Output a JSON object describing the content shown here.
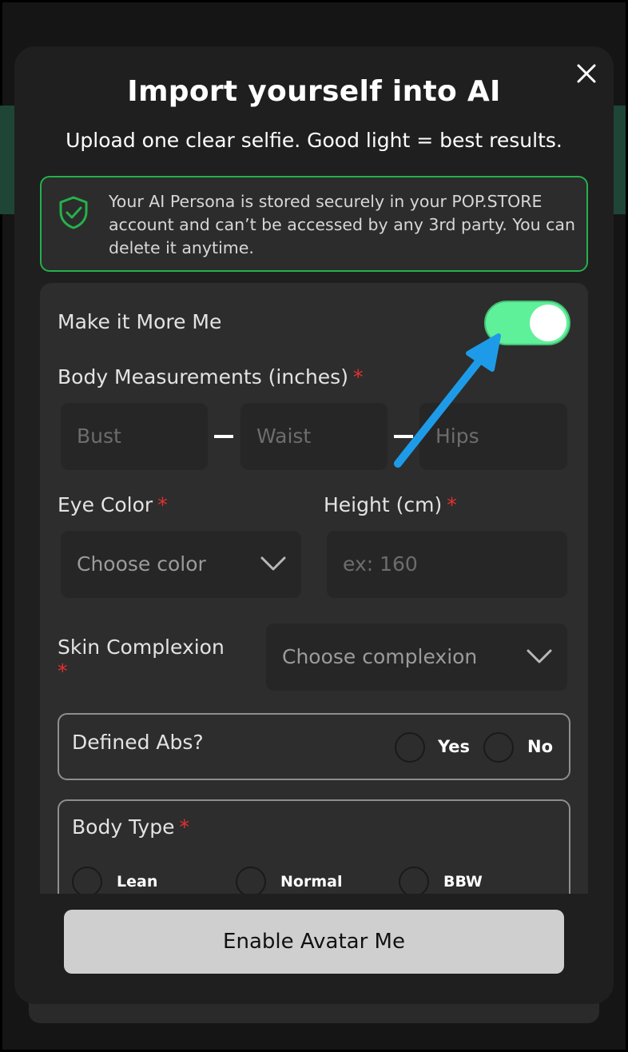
{
  "modal": {
    "title": "Import yourself into AI",
    "subtitle": "Upload one clear selfie. Good light = best results.",
    "close_icon": "close-icon"
  },
  "secure_notice": {
    "icon": "shield-check-icon",
    "text": "Your AI Persona is stored securely in your POP.STORE account and can’t be accessed by any 3rd party. You can delete it anytime.",
    "color": "#24b14a"
  },
  "form": {
    "more_me_label": "Make it More Me",
    "more_me_toggle_on": true,
    "toggle_color": "#5ff09a",
    "body_measurements_label": "Body Measurements (inches)",
    "required_mark": "*",
    "bust_placeholder": "Bust",
    "waist_placeholder": "Waist",
    "hips_placeholder": "Hips",
    "eye_color_label": "Eye Color",
    "eye_color_value": "Choose color",
    "height_label": "Height (cm)",
    "height_placeholder": "ex: 160",
    "skin_label": "Skin Complexion",
    "skin_value": "Choose complexion",
    "abs_label": "Defined Abs?",
    "abs_yes": "Yes",
    "abs_no": "No",
    "body_type_label": "Body Type",
    "body_type_options": [
      "Lean",
      "Normal",
      "BBW"
    ]
  },
  "cta": {
    "label": "Enable Avatar Me"
  }
}
